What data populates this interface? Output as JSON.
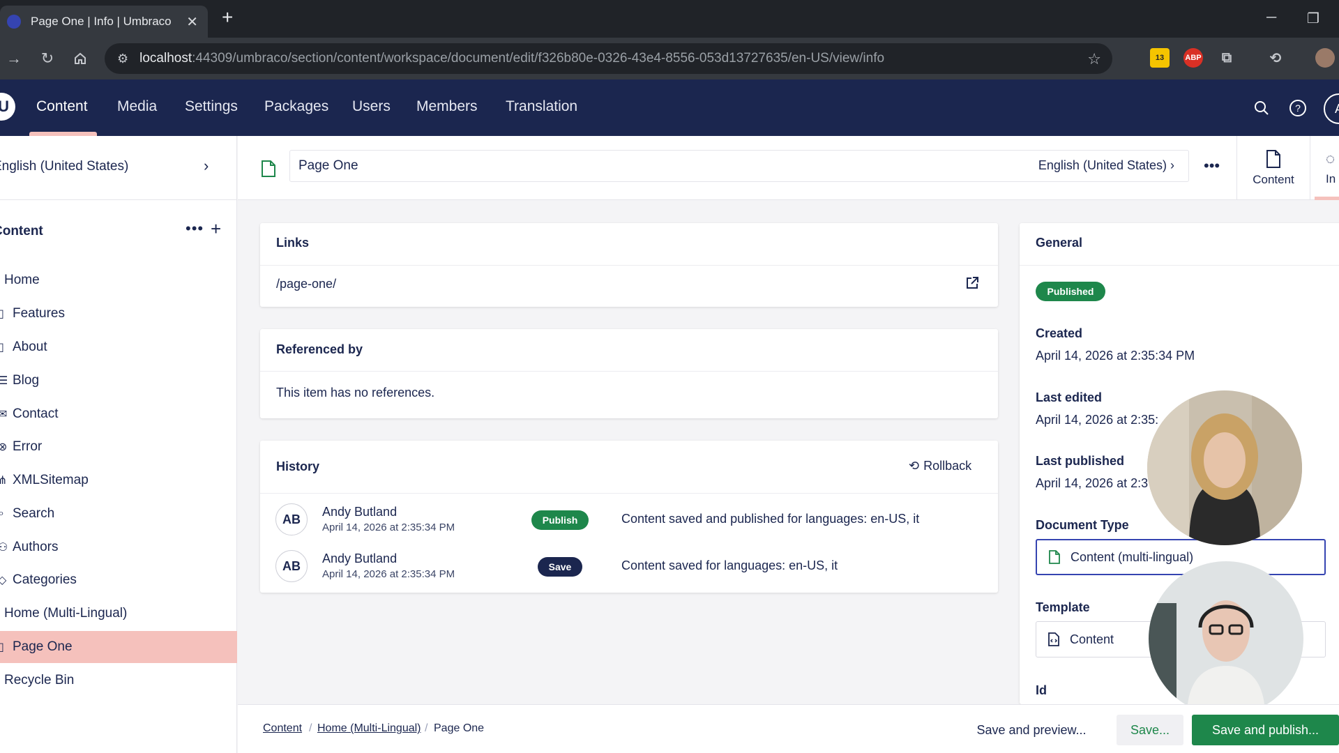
{
  "browser": {
    "tab_title": "Page One | Info | Umbraco",
    "url_host": "localhost",
    "url_path": ":44309/umbraco/section/content/workspace/document/edit/f326b80e-0326-43e4-8556-053d13727635/en-US/view/info",
    "ext_badge": "13",
    "abp": "ABP"
  },
  "header": {
    "logo": "U",
    "sections": [
      "Content",
      "Media",
      "Settings",
      "Packages",
      "Users",
      "Members",
      "Translation"
    ],
    "avatar": "A"
  },
  "sidebar": {
    "language": "English (United States)",
    "tree_title": "Content",
    "items": [
      "Home",
      "Features",
      "About",
      "Blog",
      "Contact",
      "Error",
      "XMLSitemap",
      "Search",
      "Authors",
      "Categories",
      "Home (Multi-Lingual)",
      "Page One",
      "Recycle Bin"
    ]
  },
  "workspace": {
    "name": "Page One",
    "language": "English (United States)",
    "views": [
      "Content",
      "In"
    ]
  },
  "links": {
    "title": "Links",
    "url": "/page-one/"
  },
  "references": {
    "title": "Referenced by",
    "empty": "This item has no references."
  },
  "history": {
    "title": "History",
    "rollback": "Rollback",
    "rows": [
      {
        "initials": "AB",
        "name": "Andy Butland",
        "date": "April 14, 2026 at 2:35:34 PM",
        "badge": "Publish",
        "message": "Content saved and published for languages: en-US, it"
      },
      {
        "initials": "AB",
        "name": "Andy Butland",
        "date": "April 14, 2026 at 2:35:34 PM",
        "badge": "Save",
        "message": "Content saved for languages: en-US, it"
      }
    ]
  },
  "general": {
    "title": "General",
    "status": "Published",
    "created_label": "Created",
    "created": "April 14, 2026 at 2:35:34 PM",
    "last_edited_label": "Last edited",
    "last_edited": "April 14, 2026 at 2:35:",
    "last_published_label": "Last published",
    "last_published": "April 14, 2026 at 2:3",
    "doc_type_label": "Document Type",
    "doc_type": "Content (multi-lingual)",
    "template_label": "Template",
    "template": "Content",
    "id_label": "Id"
  },
  "footer": {
    "crumbs": [
      "Content",
      "Home (Multi-Lingual)",
      "Page One"
    ],
    "save_preview": "Save and preview...",
    "save": "Save...",
    "save_publish": "Save and publish..."
  },
  "colors": {
    "header_bg": "#1b264f",
    "accent_pink": "#f5c1bc",
    "published_green": "#1e874b",
    "save_navy": "#1b264f"
  }
}
